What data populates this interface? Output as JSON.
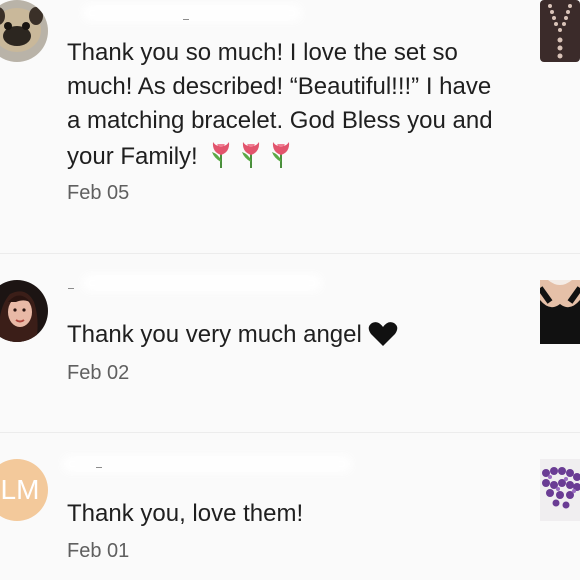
{
  "reviews": [
    {
      "avatar_icon": "pug-avatar-icon",
      "text": "Thank you so much! I love the set so much! As described! “Beautiful!!!” I have a matching bracelet. God Bless you and your Family!",
      "emoji_icon": "tulip-icon",
      "emoji_count": 3,
      "date": "Feb 05",
      "thumbnail_icon": "necklace-thumbnail-icon"
    },
    {
      "avatar_icon": "woman-avatar-icon",
      "text": "Thank you very much angel",
      "emoji_icon": "black-heart-icon",
      "date": "Feb 02",
      "thumbnail_icon": "black-top-thumbnail-icon"
    },
    {
      "avatar_initials": "LM",
      "text": "Thank you, love them!",
      "date": "Feb 01",
      "thumbnail_icon": "amethyst-bracelet-thumbnail-icon"
    }
  ],
  "colors": {
    "background": "#fafafa",
    "text": "#1f1f1f",
    "date": "#5f5f5f",
    "initials_avatar": "#f3c99b",
    "initials_text": "#ffffff"
  }
}
